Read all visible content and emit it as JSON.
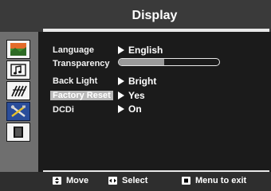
{
  "header": {
    "title": "Display"
  },
  "sidebar": {
    "icons": [
      {
        "name": "picture-icon",
        "active": false
      },
      {
        "name": "sound-icon",
        "active": false
      },
      {
        "name": "channel-icon",
        "active": false
      },
      {
        "name": "setup-icon",
        "active": true
      },
      {
        "name": "book-icon",
        "active": false
      }
    ]
  },
  "menu": {
    "items": [
      {
        "label": "Language",
        "value": "English",
        "selected": false
      },
      {
        "label": "Transparency",
        "value": "",
        "selected": false
      },
      {
        "label": "Back Light",
        "value": "Bright",
        "selected": false
      },
      {
        "label": "Factory Reset",
        "value": "Yes",
        "selected": true
      },
      {
        "label": "DCDi",
        "value": "On",
        "selected": false
      }
    ],
    "transparency_level": 0.45
  },
  "footer": {
    "hints": [
      {
        "key": "move-key",
        "label": "Move"
      },
      {
        "key": "select-key",
        "label": "Select"
      },
      {
        "key": "menu-key",
        "label": "Menu to exit"
      }
    ]
  }
}
